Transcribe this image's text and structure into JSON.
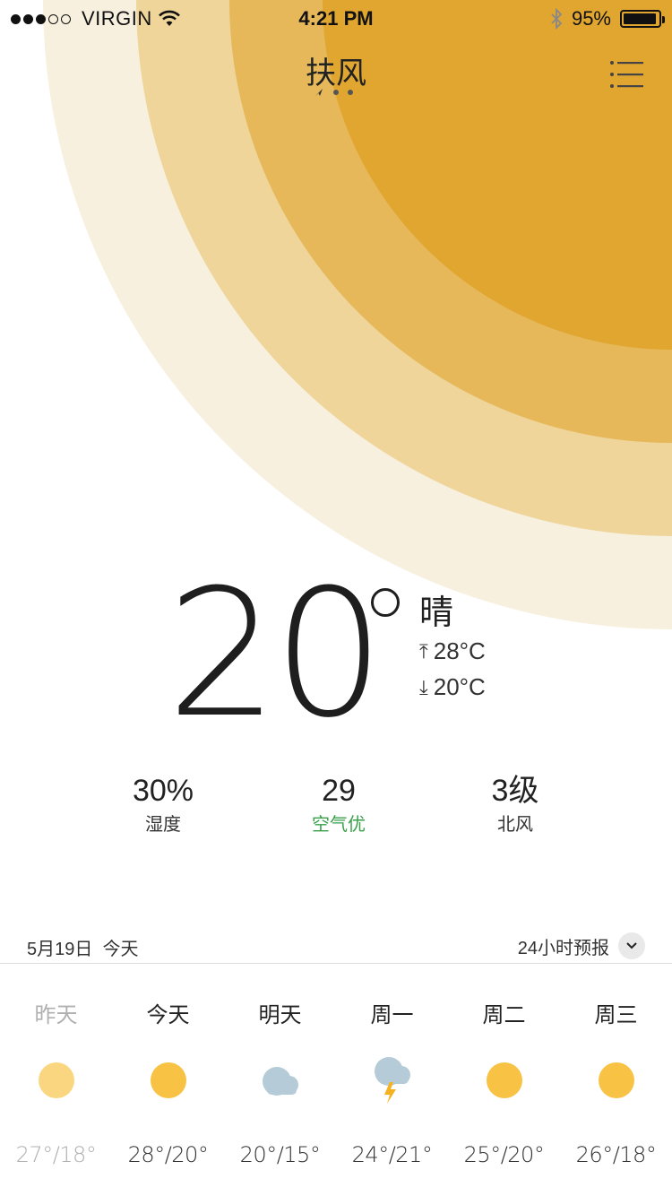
{
  "status_bar": {
    "carrier": "VIRGIN",
    "time": "4:21 PM",
    "battery": "95%",
    "battery_level": 0.95
  },
  "header": {
    "city": "扶风"
  },
  "current": {
    "temperature": "20",
    "condition": "晴",
    "high": "28°C",
    "low": "20°C"
  },
  "stats": [
    {
      "value": "30%",
      "label": "湿度"
    },
    {
      "value": "29",
      "label": "空气优"
    },
    {
      "value": "3级",
      "label": "北风"
    }
  ],
  "date_bar": {
    "date": "5月19日  今天",
    "forecast_toggle": "24小时预报"
  },
  "forecast": [
    {
      "day": "昨天",
      "icon": "sun-icon",
      "temps": "27°/18°"
    },
    {
      "day": "今天",
      "icon": "sun-icon",
      "temps": "28°/20°"
    },
    {
      "day": "明天",
      "icon": "cloud-icon",
      "temps": "20°/15°"
    },
    {
      "day": "周一",
      "icon": "thunderstorm-icon",
      "temps": "24°/21°"
    },
    {
      "day": "周二",
      "icon": "sun-icon",
      "temps": "25°/20°"
    },
    {
      "day": "周三",
      "icon": "sun-icon",
      "temps": "26°/18°"
    }
  ],
  "colors": {
    "sun_core": "#E0A630",
    "sun_ring2": "#E6B85A",
    "sun_ring3": "#EFD59A",
    "sun_ring4": "#F8F0DF",
    "air_good": "#3AA04A",
    "icon_sun": "#F8C244",
    "icon_sun_past": "#FBD680",
    "icon_cloud": "#B5CCD8",
    "icon_bolt": "#F6B21E"
  }
}
